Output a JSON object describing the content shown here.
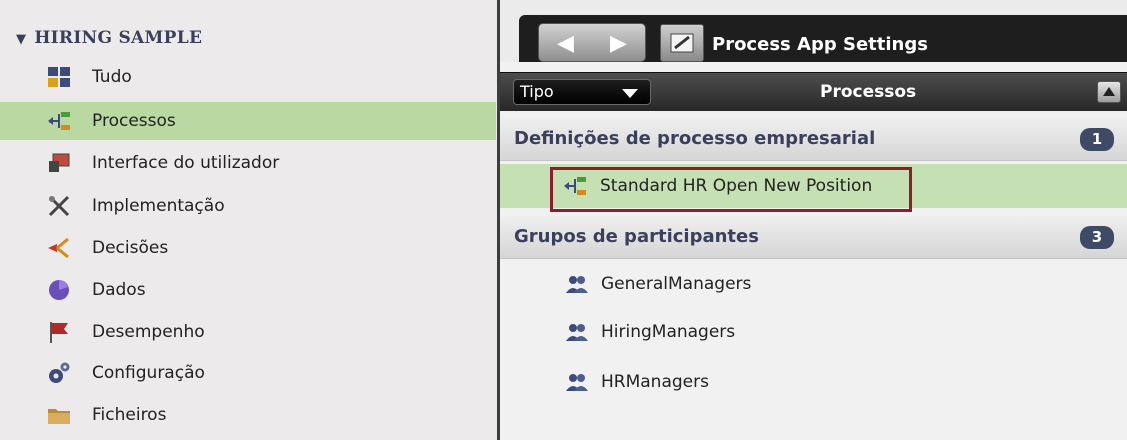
{
  "sidebar": {
    "header": "HIRING SAMPLE",
    "items": [
      {
        "label": "Tudo",
        "icon": "grid-icon",
        "active": false
      },
      {
        "label": "Processos",
        "icon": "process-icon",
        "active": true
      },
      {
        "label": "Interface do utilizador",
        "icon": "user-interface-icon",
        "active": false
      },
      {
        "label": "Implementação",
        "icon": "tools-icon",
        "active": false
      },
      {
        "label": "Decisões",
        "icon": "decision-icon",
        "active": false
      },
      {
        "label": "Dados",
        "icon": "data-icon",
        "active": false
      },
      {
        "label": "Desempenho",
        "icon": "flag-icon",
        "active": false
      },
      {
        "label": "Configuração",
        "icon": "gears-icon",
        "active": false
      },
      {
        "label": "Ficheiros",
        "icon": "folder-icon",
        "active": false
      }
    ]
  },
  "tabbar": {
    "title": "Process App Settings"
  },
  "toolbar": {
    "type_label": "Tipo",
    "title": "Processos"
  },
  "sections": [
    {
      "label": "Definições de processo empresarial",
      "count": "1",
      "items": [
        {
          "label": "Standard HR Open New Position",
          "icon": "process-icon"
        }
      ]
    },
    {
      "label": "Grupos de participantes",
      "count": "3",
      "items": [
        {
          "label": "GeneralManagers",
          "icon": "users-icon"
        },
        {
          "label": "HiringManagers",
          "icon": "users-icon"
        },
        {
          "label": "HRManagers",
          "icon": "users-icon"
        }
      ]
    }
  ],
  "colors": {
    "active_row": "#b9d8a2",
    "highlight_border": "#8b1f2c",
    "badge": "#3e4a66",
    "header_text": "#3a3f5c"
  }
}
